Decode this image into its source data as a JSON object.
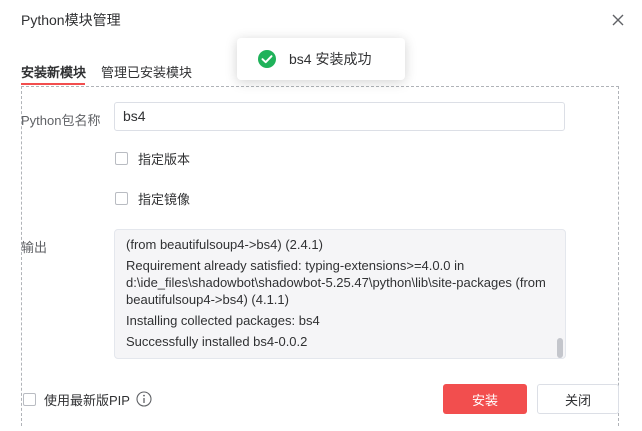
{
  "dialog": {
    "title": "Python模块管理",
    "close_icon": "close-icon"
  },
  "tabs": [
    {
      "label": "安装新模块",
      "active": true
    },
    {
      "label": "管理已安装模块",
      "active": false
    }
  ],
  "form": {
    "package_name_label": "Python包名称",
    "package_name_value": "bs4",
    "specify_version_label": "指定版本",
    "specify_version_checked": false,
    "specify_mirror_label": "指定镜像",
    "specify_mirror_checked": false,
    "output_label": "输出"
  },
  "output": {
    "lines": [
      "(from beautifulsoup4->bs4) (2.4.1)",
      "Requirement already satisfied: typing-extensions>=4.0.0 in d:\\ide_files\\shadowbot\\shadowbot-5.25.47\\python\\lib\\site-packages (from beautifulsoup4->bs4) (4.1.1)",
      "Installing collected packages: bs4",
      "Successfully installed bs4-0.0.2"
    ]
  },
  "footer": {
    "use_latest_pip_label": "使用最新版PIP",
    "use_latest_pip_checked": false,
    "info_icon": "info-icon",
    "install_label": "安装",
    "close_label": "关闭"
  },
  "toast": {
    "icon": "success-check-icon",
    "message": "bs4 安装成功"
  },
  "colors": {
    "accent": "#f24e4e",
    "success": "#1fb25a"
  }
}
